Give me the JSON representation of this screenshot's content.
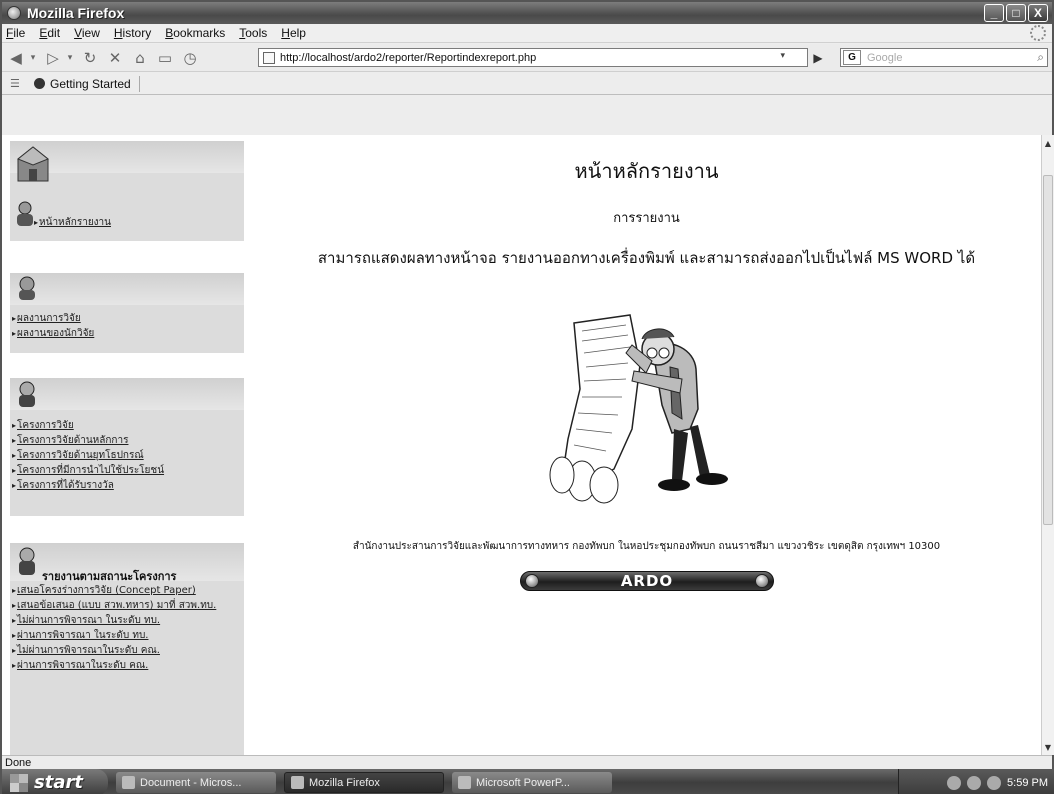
{
  "window": {
    "title": "Mozilla Firefox",
    "buttons": [
      "_",
      "□",
      "X"
    ]
  },
  "menu": [
    "File",
    "Edit",
    "View",
    "History",
    "Bookmarks",
    "Tools",
    "Help"
  ],
  "nav": {
    "url": "http://localhost/ardo2/reporter/Reportindexreport.php",
    "search_placeholder": "Google"
  },
  "bookmarks": {
    "items": [
      "Getting Started"
    ]
  },
  "sidebar": {
    "home_link": "หน้าหลักรายงาน",
    "group2": [
      "ผลงานการวิจัย",
      "ผลงานของนักวิจัย"
    ],
    "group3": [
      "โครงการวิจัย",
      "โครงการวิจัยด้านหลักการ",
      "โครงการวิจัยด้านยุทโธปกรณ์",
      "โครงการที่มีการนำไปใช้ประโยชน์",
      "โครงการที่ได้รับรางวัล"
    ],
    "group4_title": "รายงานตามสถานะโครงการ",
    "group4": [
      "เสนอโครงร่างการวิจัย (Concept Paper)",
      "เสนอข้อเสนอ (แบบ สวพ.ทหาร) มาที่ สวพ.ทบ.",
      "ไม่ผ่านการพิจารณา ในระดับ ทบ.",
      "ผ่านการพิจารณา ในระดับ ทบ.",
      "ไม่ผ่านการพิจารณาในระดับ คณ.",
      "ผ่านการพิจารณาในระดับ คณ."
    ]
  },
  "main": {
    "title": "หน้าหลักรายงาน",
    "subtitle": "การรายงาน",
    "description": "สามารถแสดงผลทางหน้าจอ รายงานออกทางเครื่องพิมพ์ และสามารถส่งออกไปเป็นไฟล์ MS WORD ได้",
    "footer": "สำนักงานประสานการวิจัยและพัฒนาการทางทหาร กองทัพบก ในหอประชุมกองทัพบก ถนนราชสีมา แขวงวชิระ เขตดุสิต กรุงเทพฯ 10300",
    "ardo_label": "ARDO"
  },
  "status": {
    "text": "Done"
  },
  "taskbar": {
    "start": "start",
    "tasks": [
      "Document - Micros...",
      "Mozilla Firefox",
      "Microsoft PowerP..."
    ],
    "clock": "5:59 PM"
  }
}
